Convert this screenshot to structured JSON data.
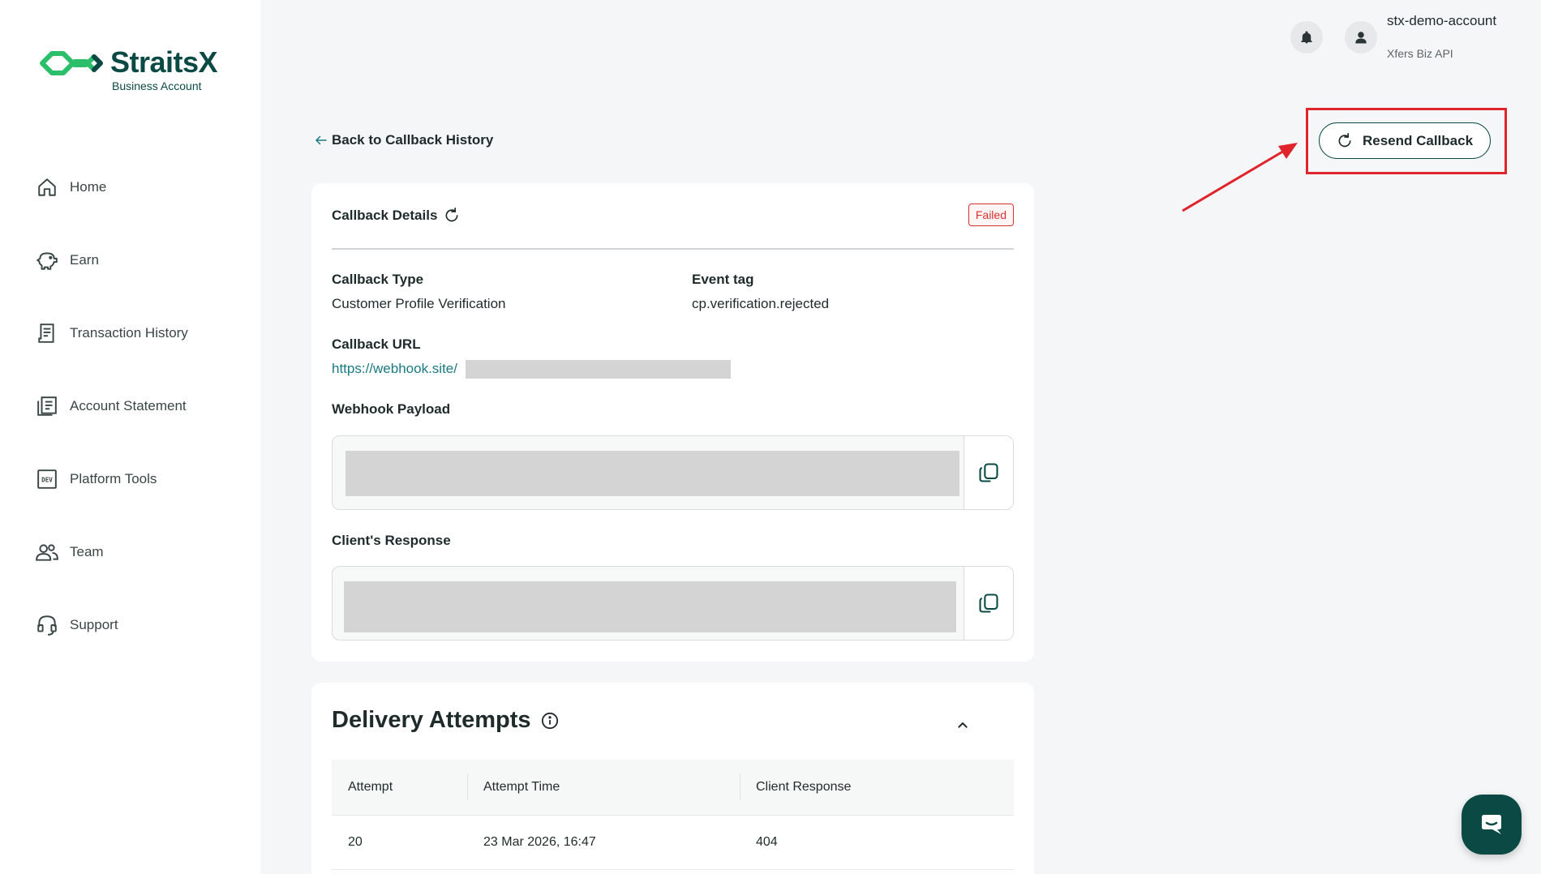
{
  "brand": {
    "name": "StraitsX",
    "subtitle": "Business Account",
    "color": "#0b4a44",
    "accent": "#2bbf6a"
  },
  "sidebar": {
    "items": [
      {
        "label": "Home",
        "icon": "home-icon"
      },
      {
        "label": "Earn",
        "icon": "piggy-bank-icon"
      },
      {
        "label": "Transaction History",
        "icon": "receipt-icon"
      },
      {
        "label": "Account Statement",
        "icon": "document-list-icon"
      },
      {
        "label": "Platform Tools",
        "icon": "dev-icon"
      },
      {
        "label": "Team",
        "icon": "team-icon"
      },
      {
        "label": "Support",
        "icon": "headset-icon"
      }
    ]
  },
  "header": {
    "account_name": "stx-demo-account",
    "account_sub": "Xfers Biz API"
  },
  "page": {
    "back_label": "Back to Callback History",
    "resend_label": "Resend Callback",
    "highlight_color": "#e0242b"
  },
  "details": {
    "title": "Callback Details",
    "status": "Failed",
    "callback_type_label": "Callback Type",
    "callback_type_value": "Customer Profile Verification",
    "event_tag_label": "Event tag",
    "event_tag_value": "cp.verification.rejected",
    "callback_url_label": "Callback URL",
    "callback_url_value": "https://webhook.site/",
    "webhook_payload_label": "Webhook Payload",
    "client_response_label": "Client's Response"
  },
  "delivery": {
    "title": "Delivery Attempts",
    "columns": [
      "Attempt",
      "Attempt Time",
      "Client Response"
    ],
    "rows": [
      {
        "attempt": "20",
        "time": "23 Mar 2026, 16:47",
        "response": "404"
      }
    ]
  }
}
